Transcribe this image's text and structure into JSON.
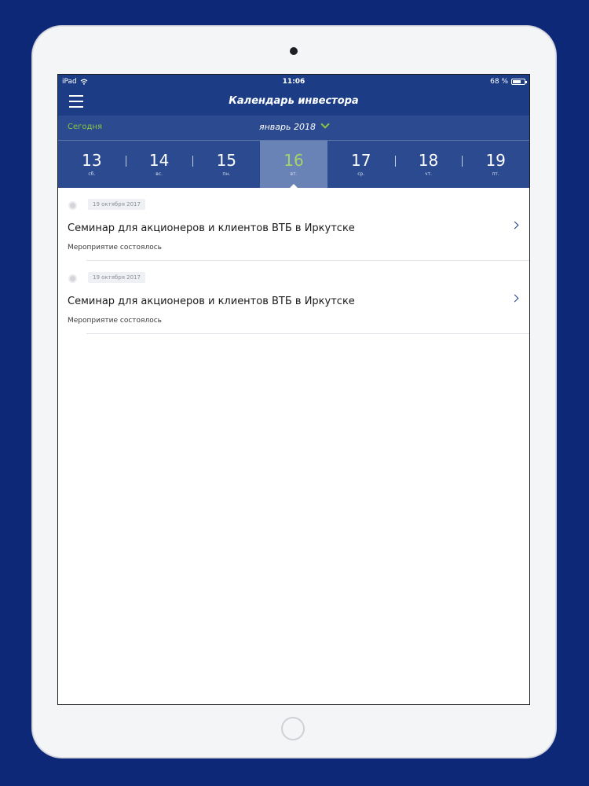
{
  "status_bar": {
    "device": "iPad",
    "time": "11:06",
    "battery": "68 %",
    "battery_level": 0.68
  },
  "header": {
    "title": "Календарь инвестора"
  },
  "month_bar": {
    "today_label": "Сегодня",
    "month_label": "январь 2018"
  },
  "days": [
    {
      "num": "13",
      "wd": "сб."
    },
    {
      "num": "14",
      "wd": "вс."
    },
    {
      "num": "15",
      "wd": "пн."
    },
    {
      "num": "16",
      "wd": "вт."
    },
    {
      "num": "17",
      "wd": "ср."
    },
    {
      "num": "18",
      "wd": "чт."
    },
    {
      "num": "19",
      "wd": "пт."
    }
  ],
  "selected_day_index": 3,
  "events": [
    {
      "date": "19 октября 2017",
      "title": "Семинар для акционеров и клиентов ВТБ в Иркутске",
      "status": "Мероприятие состоялось"
    },
    {
      "date": "19 октября 2017",
      "title": "Семинар для акционеров и клиентов ВТБ в Иркутске",
      "status": "Мероприятие состоялось"
    }
  ],
  "colors": {
    "navy": "#1c3d86",
    "bar": "#2b4a8f",
    "selected": "#6a83b6",
    "accent_green": "#8cc63f"
  }
}
